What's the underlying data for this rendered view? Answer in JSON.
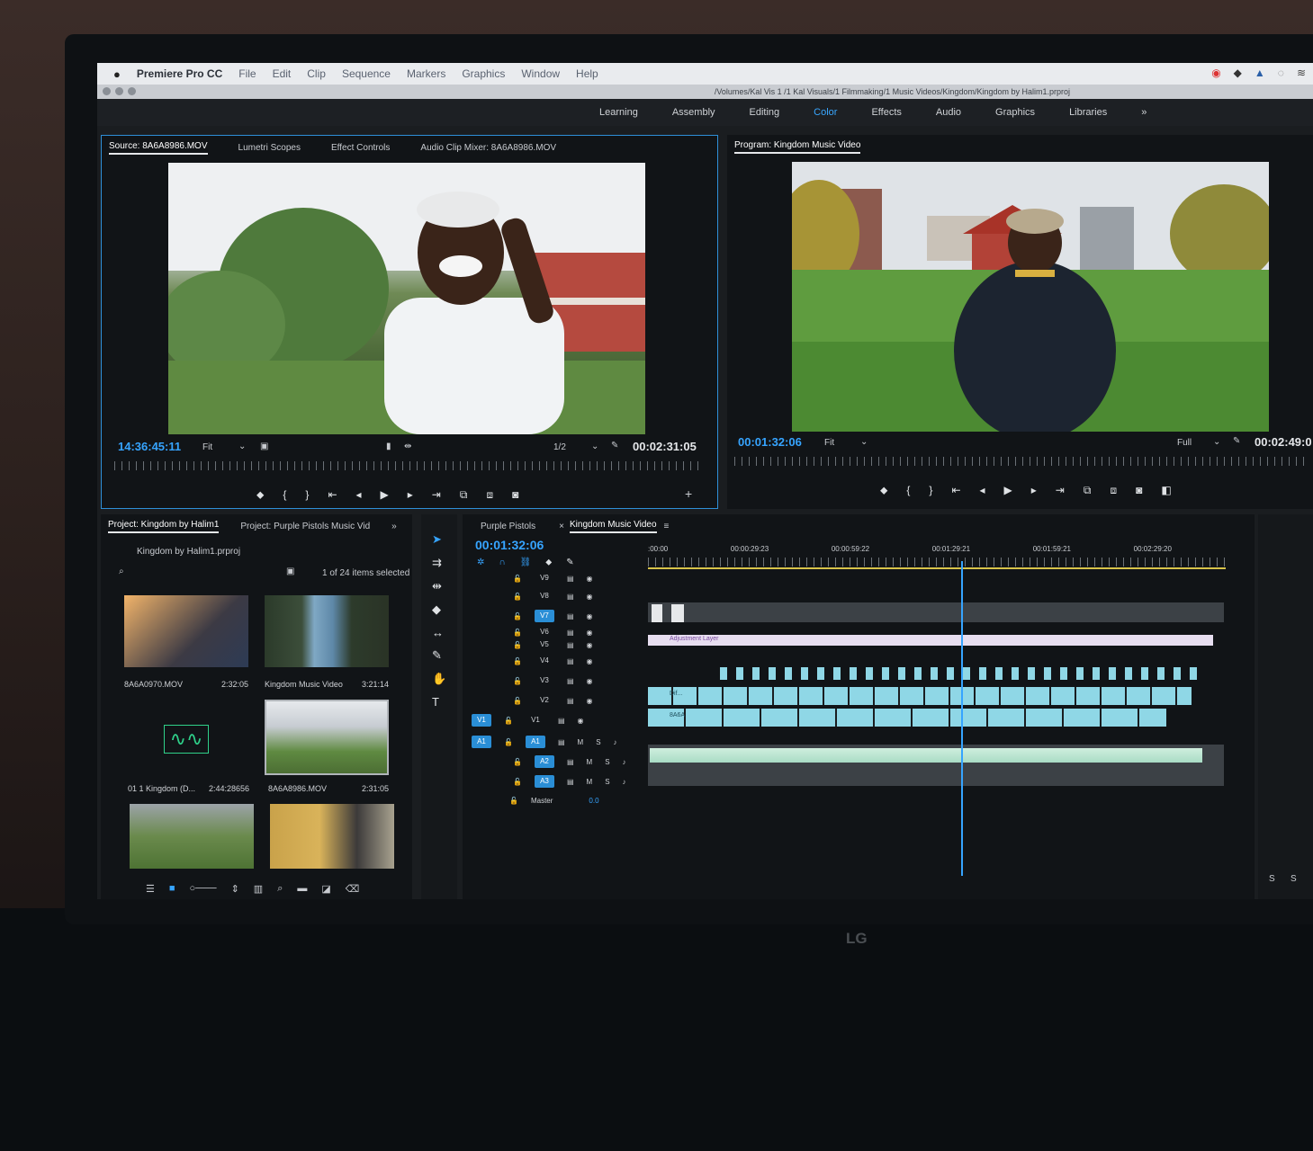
{
  "menubar": {
    "app_name": "Premiere Pro CC",
    "items": [
      "File",
      "Edit",
      "Clip",
      "Sequence",
      "Markers",
      "Graphics",
      "Window",
      "Help"
    ]
  },
  "window": {
    "path": "/Volumes/Kal Vis 1 /1 Kal Visuals/1 Filmmaking/1 Music Videos/Kingdom/Kingdom by Halim1.prproj"
  },
  "workspaces": {
    "items": [
      "Learning",
      "Assembly",
      "Editing",
      "Color",
      "Effects",
      "Audio",
      "Graphics",
      "Libraries"
    ],
    "active": "Color",
    "more": "»"
  },
  "source_panel": {
    "tabs": [
      "Source: 8A6A8986.MOV",
      "Lumetri Scopes",
      "Effect Controls",
      "Audio Clip Mixer: 8A6A8986.MOV"
    ],
    "timecode": "14:36:45:11",
    "fit": "Fit",
    "resolution": "1/2",
    "duration": "00:02:31:05"
  },
  "program_panel": {
    "tab": "Program: Kingdom Music Video",
    "timecode": "00:01:32:06",
    "fit": "Fit",
    "resolution": "Full",
    "duration": "00:02:49:0"
  },
  "project_panel": {
    "tabs": [
      "Project: Kingdom by Halim1",
      "Project: Purple Pistols Music Vid"
    ],
    "file": "Kingdom by Halim1.prproj",
    "selection": "1 of 24 items selected",
    "items": [
      {
        "name": "8A6A0970.MOV",
        "duration": "2:32:05"
      },
      {
        "name": "Kingdom Music Video",
        "duration": "3:21:14"
      },
      {
        "name": "01 1 Kingdom (D...",
        "duration": "2:44:28656"
      },
      {
        "name": "8A6A8986.MOV",
        "duration": "2:31:05"
      }
    ]
  },
  "timeline": {
    "tabs": [
      "Purple Pistols",
      "Kingdom Music Video"
    ],
    "timecode": "00:01:32:06",
    "ruler_labels": [
      ":00:00",
      "00:00:29:23",
      "00:00:59:22",
      "00:01:29:21",
      "00:01:59:21",
      "00:02:29:20"
    ],
    "video_tracks": [
      "V9",
      "V8",
      "V7",
      "V6",
      "V5",
      "V4",
      "V3",
      "V2",
      "V1"
    ],
    "audio_tracks": [
      "A1",
      "A2",
      "A3"
    ],
    "source_v": "V1",
    "source_a": "A1",
    "master_label": "Master",
    "master_value": "0.0",
    "clip_labels": [
      "Adjustment Layer",
      "Dif...",
      "8A6A"
    ],
    "track_buttons": {
      "mute": "M",
      "solo": "S"
    }
  },
  "right_strip": {
    "labels": [
      "S",
      "S"
    ]
  },
  "brand": "LG"
}
